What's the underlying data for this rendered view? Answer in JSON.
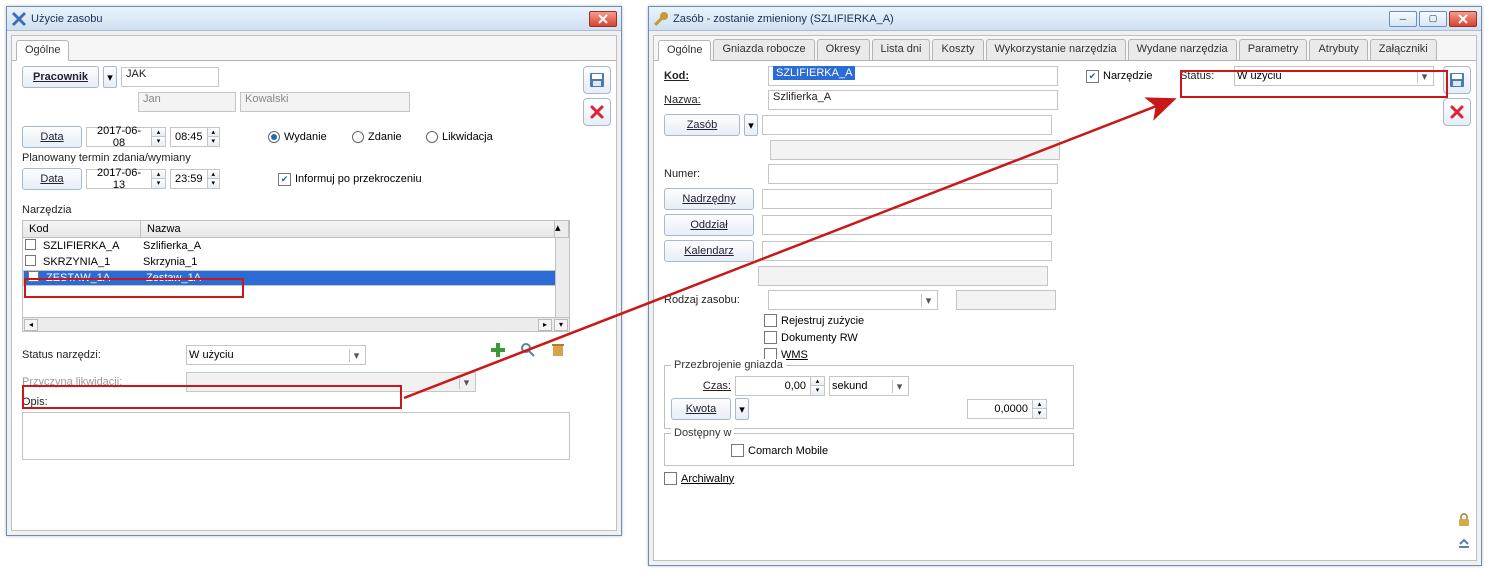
{
  "win1": {
    "title": "Użycie zasobu",
    "tabs": [
      "Ogólne"
    ],
    "pracownik_btn": "Pracownik",
    "pracownik_code": "JAK",
    "pracownik_first": "Jan",
    "pracownik_last": "Kowalski",
    "data_btn": "Data",
    "date1": "2017-06-08",
    "time1": "08:45",
    "radio_wydanie": "Wydanie",
    "radio_zdanie": "Zdanie",
    "radio_likwidacja": "Likwidacja",
    "plan_label": "Planowany termin zdania/wymiany",
    "date2": "2017-06-13",
    "time2": "23:59",
    "informuj": "Informuj po przekroczeniu",
    "narzedzia_label": "Narzędzia",
    "cols": {
      "kod": "Kod",
      "nazwa": "Nazwa"
    },
    "rows": [
      {
        "kod": "SZLIFIERKA_A",
        "nazwa": "Szlifierka_A"
      },
      {
        "kod": "SKRZYNIA_1",
        "nazwa": "Skrzynia_1"
      },
      {
        "kod": "ZESTAW_1A",
        "nazwa": "Zestaw_1A"
      }
    ],
    "status_label": "Status narzędzi:",
    "status_value": "W użyciu",
    "przyczyna_label": "Przyczyna likwidacji:",
    "opis_label": "Opis:"
  },
  "win2": {
    "title": "Zasób - zostanie zmieniony  (SZLIFIERKA_A)",
    "tabs": [
      "Ogólne",
      "Gniazda robocze",
      "Okresy",
      "Lista dni",
      "Koszty",
      "Wykorzystanie narzędzia",
      "Wydane narzędzia",
      "Parametry",
      "Atrybuty",
      "Załączniki"
    ],
    "kod_label": "Kod:",
    "kod_value": "SZLIFIERKA_A",
    "narzedzie_label": "Narzędzie",
    "status_label": "Status:",
    "status_value": "W użyciu",
    "nazwa_label": "Nazwa:",
    "nazwa_value": "Szlifierka_A",
    "zasob_btn": "Zasób",
    "numer_label": "Numer:",
    "nadrzedny_btn": "Nadrzędny",
    "oddzial_btn": "Oddział",
    "kalendarz_btn": "Kalendarz",
    "rodzaj_label": "Rodzaj zasobu:",
    "chk_rejestruj": "Rejestruj zużycie",
    "chk_dokumenty": "Dokumenty RW",
    "chk_wms": "WMS",
    "przezbrojenie_title": "Przezbrojenie gniazda",
    "czas_label": "Czas:",
    "czas_value": "0,00",
    "czas_unit": "sekund",
    "kwota_btn": "Kwota",
    "kwota_value": "0,0000",
    "dostepny_title": "Dostępny w",
    "comarch_label": "Comarch Mobile",
    "archiwalny_label": "Archiwalny"
  }
}
